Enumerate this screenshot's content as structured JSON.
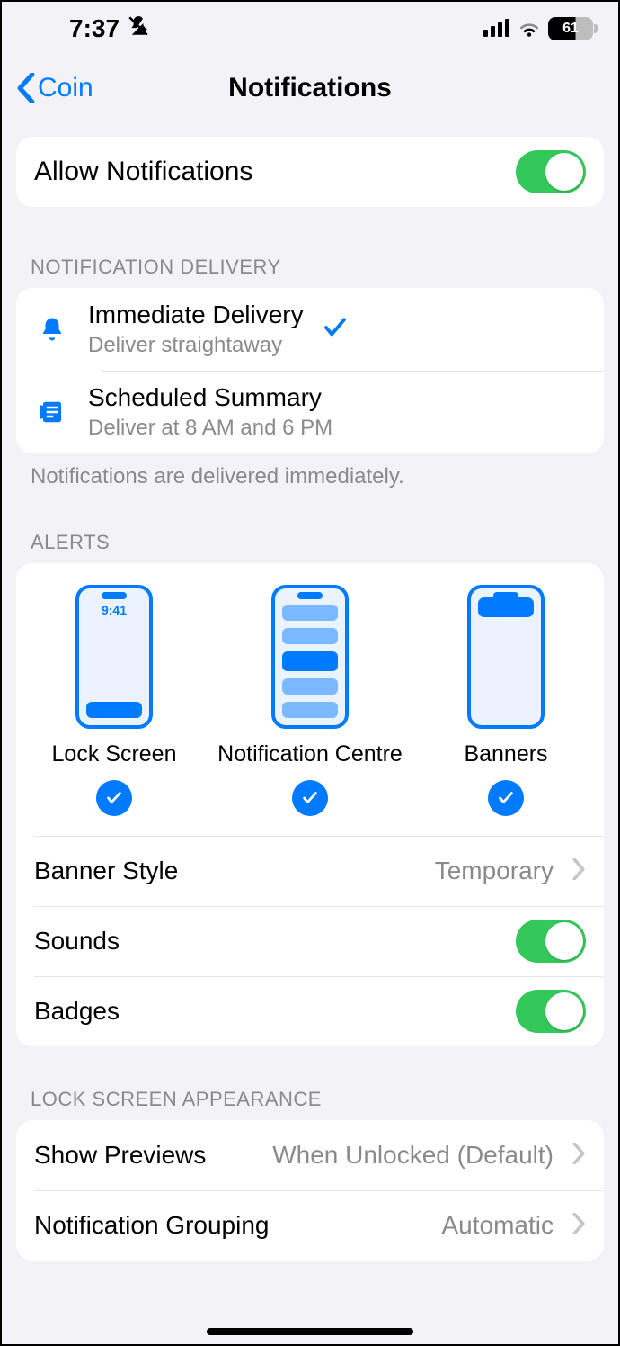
{
  "status": {
    "time": "7:37",
    "battery": "61"
  },
  "nav": {
    "back": "Coin",
    "title": "Notifications"
  },
  "allow": {
    "label": "Allow Notifications",
    "on": true
  },
  "delivery": {
    "header": "NOTIFICATION DELIVERY",
    "items": [
      {
        "title": "Immediate Delivery",
        "subtitle": "Deliver straightaway",
        "selected": true
      },
      {
        "title": "Scheduled Summary",
        "subtitle": "Deliver at 8 AM and 6 PM",
        "selected": false
      }
    ],
    "footer": "Notifications are delivered immediately."
  },
  "alerts": {
    "header": "ALERTS",
    "preview_time": "9:41",
    "columns": [
      {
        "label": "Lock Screen",
        "checked": true
      },
      {
        "label": "Notification Centre",
        "checked": true
      },
      {
        "label": "Banners",
        "checked": true
      }
    ],
    "banner_style": {
      "label": "Banner Style",
      "value": "Temporary"
    },
    "sounds": {
      "label": "Sounds",
      "on": true
    },
    "badges": {
      "label": "Badges",
      "on": true
    }
  },
  "lockscreen": {
    "header": "LOCK SCREEN APPEARANCE",
    "previews": {
      "label": "Show Previews",
      "value": "When Unlocked (Default)"
    },
    "grouping": {
      "label": "Notification Grouping",
      "value": "Automatic"
    }
  }
}
